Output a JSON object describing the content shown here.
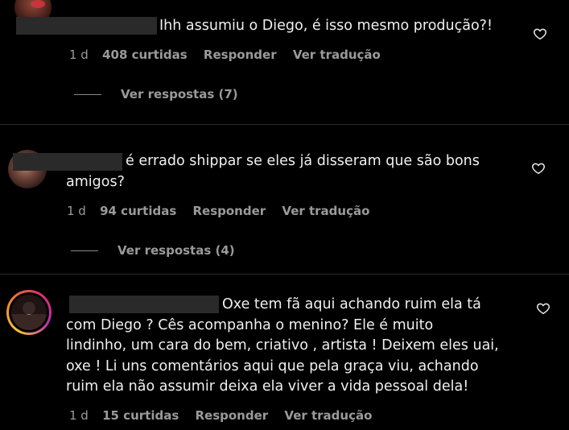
{
  "comments": [
    {
      "text": "Ihh assumiu o Diego, é isso mesmo produção?!",
      "time": "1 d",
      "likes": "408 curtidas",
      "reply": "Responder",
      "translate": "Ver tradução",
      "view_replies": "Ver respostas (7)"
    },
    {
      "text": "é errado shippar se eles já disseram que são bons\namigos?",
      "time": "1 d",
      "likes": "94 curtidas",
      "reply": "Responder",
      "translate": "Ver tradução",
      "view_replies": "Ver respostas (4)"
    },
    {
      "text": "Oxe tem fã aqui achando ruim ela tá\ncom Diego ? Cês acompanha o menino? Ele é muito\nlindinho, um cara do bem, criativo , artista ! Deixem eles uai,\noxe ! Li uns comentários aqui que pela graça viu, achando\nruim ela não assumir deixa ela viver a vida pessoal dela!",
      "time": "1 d",
      "likes": "15 curtidas",
      "reply": "Responder",
      "translate": "Ver tradução"
    }
  ],
  "icons": {
    "like": "heart-icon"
  },
  "colors": {
    "background": "#000000",
    "text": "#f0f0f0",
    "muted": "#9a9a9a",
    "redaction": "#2a2a2a"
  }
}
